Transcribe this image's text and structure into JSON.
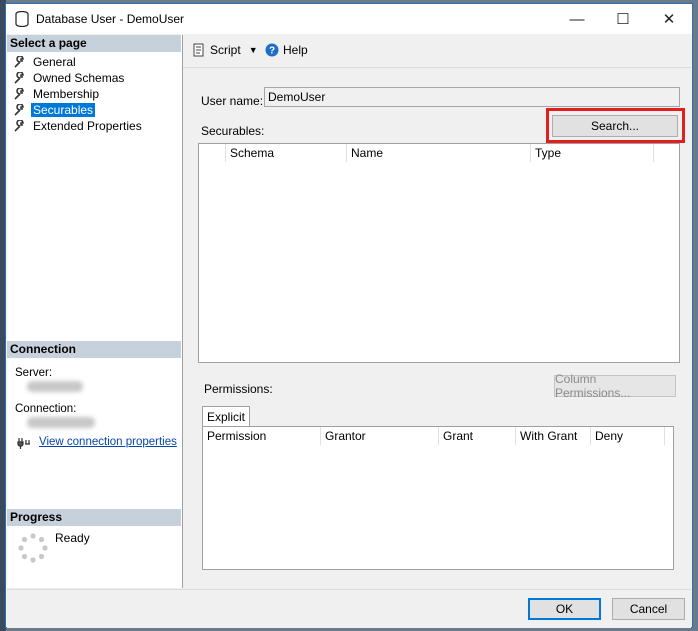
{
  "window": {
    "title": "Database User - DemoUser",
    "controls": {
      "minimize": "—",
      "maximize": "☐",
      "close": "✕"
    }
  },
  "left_pane": {
    "select_page_header": "Select a page",
    "pages": [
      {
        "label": "General",
        "selected": false
      },
      {
        "label": "Owned Schemas",
        "selected": false
      },
      {
        "label": "Membership",
        "selected": false
      },
      {
        "label": "Securables",
        "selected": true
      },
      {
        "label": "Extended Properties",
        "selected": false
      }
    ],
    "connection_header": "Connection",
    "server_label": "Server:",
    "connection_label": "Connection:",
    "view_connection_link": "View connection properties",
    "progress_header": "Progress",
    "progress_status": "Ready"
  },
  "toolbar": {
    "script_label": "Script",
    "help_label": "Help"
  },
  "main": {
    "user_name_label": "User name:",
    "user_name_value": "DemoUser",
    "securables_label": "Securables:",
    "search_button": "Search...",
    "securables_columns": [
      "",
      "Schema",
      "Name",
      "Type"
    ],
    "permissions_label": "Permissions:",
    "column_permissions_button": "Column Permissions...",
    "permissions_tab": "Explicit",
    "permissions_columns": [
      "Permission",
      "Grantor",
      "Grant",
      "With Grant",
      "Deny"
    ]
  },
  "footer": {
    "ok_button": "OK",
    "cancel_button": "Cancel"
  },
  "colors": {
    "highlight": "#e0201f",
    "selection": "#0078d7",
    "link": "#0645ad"
  }
}
